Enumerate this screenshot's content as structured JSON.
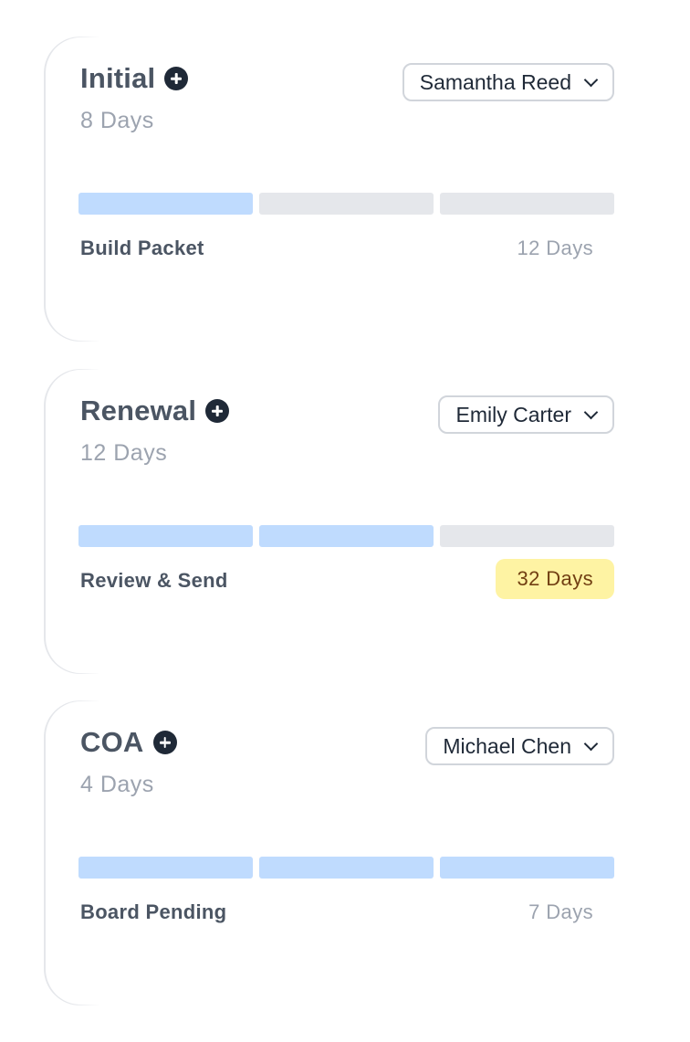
{
  "cards": [
    {
      "title": "Initial",
      "days": "8 Days",
      "assignee": "Samantha Reed",
      "progress": {
        "completed": 1,
        "total": 3
      },
      "stage": "Build Packet",
      "stage_days": "12 Days",
      "stage_days_highlight": false
    },
    {
      "title": "Renewal",
      "days": "12 Days",
      "assignee": "Emily Carter",
      "progress": {
        "completed": 2,
        "total": 3
      },
      "stage": "Review & Send",
      "stage_days": "32 Days",
      "stage_days_highlight": true
    },
    {
      "title": "COA",
      "days": "4 Days",
      "assignee": "Michael Chen",
      "progress": {
        "completed": 3,
        "total": 3
      },
      "stage": "Board Pending",
      "stage_days": "7 Days",
      "stage_days_highlight": false
    }
  ],
  "colors": {
    "progress_done": "#bfdbfe",
    "progress_pending": "#e5e7eb",
    "alert_badge": "#fef3a3"
  },
  "icons": {
    "add": "plus-circle-icon",
    "dropdown": "chevron-down-icon"
  }
}
